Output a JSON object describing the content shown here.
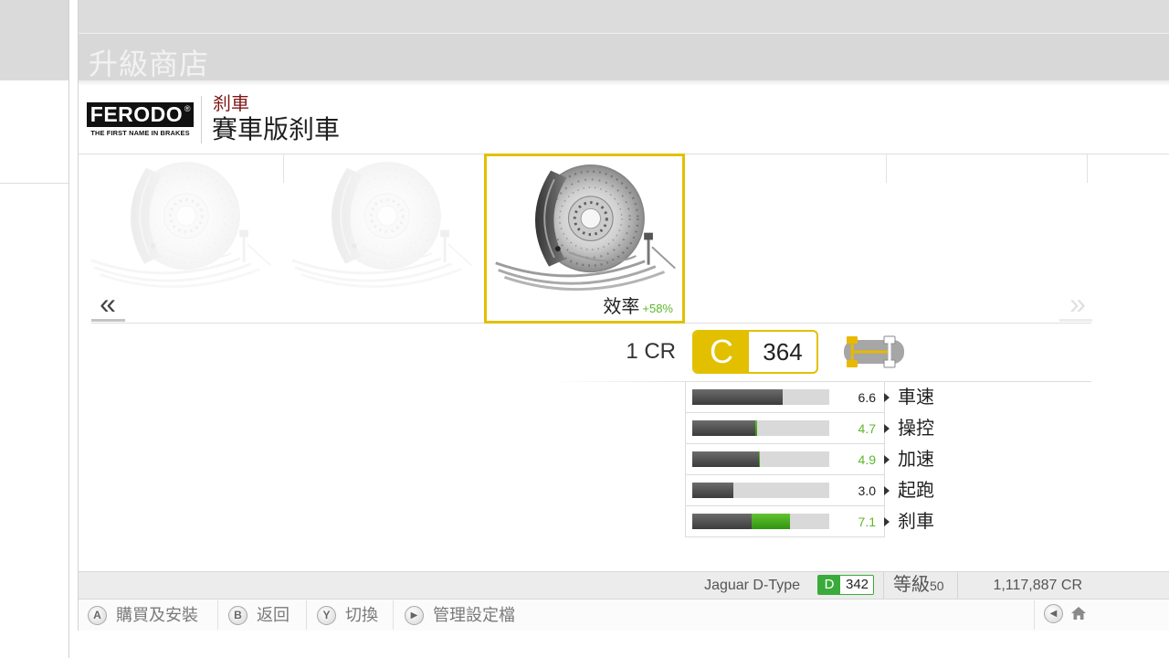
{
  "window": {
    "title": "升級商店"
  },
  "brand": {
    "logo_name": "FERODO",
    "logo_mark": "®",
    "logo_tagline": "THE FIRST NAME IN BRAKES",
    "category": "刹車",
    "part_name": "賽車版刹車"
  },
  "carousel": {
    "prev_arrow": "«",
    "next_arrow": "»",
    "prev_icon": "double-chevron-left-icon",
    "next_icon": "double-chevron-right-icon",
    "items": [
      {
        "icon": "brake-kit-image",
        "state": "unselected"
      },
      {
        "icon": "brake-disc-image",
        "state": "unselected"
      },
      {
        "icon": "race-brake-kit-image",
        "state": "selected",
        "stat_label": "效率",
        "stat_delta": "+58%"
      }
    ]
  },
  "purchase": {
    "price": "1 CR",
    "class_letter": "C",
    "performance_index": "364",
    "drivetrain_icon": "car-drivetrain-icon"
  },
  "stats_scale_max": 10,
  "stats": [
    {
      "label": "車速",
      "value": "6.6",
      "current": 6.6,
      "upgraded": 6.6,
      "improved": false
    },
    {
      "label": "操控",
      "value": "4.7",
      "current": 4.6,
      "upgraded": 4.7,
      "improved": true
    },
    {
      "label": "加速",
      "value": "4.9",
      "current": 4.85,
      "upgraded": 4.9,
      "improved": true
    },
    {
      "label": "起跑",
      "value": "3.0",
      "current": 3.0,
      "upgraded": 3.0,
      "improved": false
    },
    {
      "label": "刹車",
      "value": "7.1",
      "current": 4.3,
      "upgraded": 7.1,
      "improved": true
    }
  ],
  "status_bar": {
    "car_name": "Jaguar D-Type",
    "car_class": "D",
    "car_pi": "342",
    "level_label": "等級",
    "level": "50",
    "credits": "1,117,887 CR"
  },
  "buttons": [
    {
      "key": "A",
      "label": "購買及安裝"
    },
    {
      "key": "B",
      "label": "返回"
    },
    {
      "key": "Y",
      "label": "切換"
    },
    {
      "key": "▶",
      "label": "管理設定檔"
    }
  ],
  "nav": {
    "back_glyph": "◀",
    "back_icon": "back-circle-icon",
    "home_icon": "home-icon"
  },
  "colors": {
    "accent_yellow": "#e2c000",
    "improved_green": "#5cb82a",
    "class_d_green": "#3aab3a",
    "category_red": "#7d1515"
  }
}
